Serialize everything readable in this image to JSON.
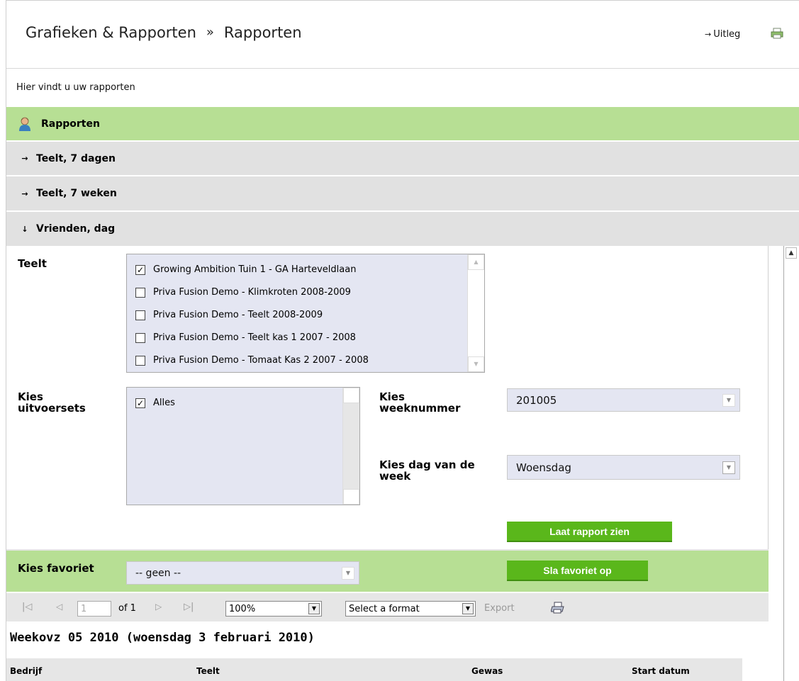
{
  "header": {
    "crumb_root": "Grafieken & Rapporten",
    "crumb_sep": "»",
    "crumb_current": "Rapporten",
    "uitleg_label": "Uitleg",
    "print_icon": "printer-icon"
  },
  "intro": "Hier vindt u uw rapporten",
  "sections": {
    "rapporten": "Rapporten",
    "teelt7dagen": "Teelt, 7 dagen",
    "teelt7weken": "Teelt, 7 weken",
    "vrienden": "Vrienden, dag",
    "collapsed_arrow": "→",
    "expanded_arrow": "↓"
  },
  "form": {
    "teelt_label": "Teelt",
    "teelt_items": [
      {
        "label": "Growing Ambition Tuin 1 - GA Harteveldlaan",
        "checked": true
      },
      {
        "label": "Priva Fusion Demo - Klimkroten 2008-2009",
        "checked": false
      },
      {
        "label": "Priva Fusion Demo - Teelt 2008-2009",
        "checked": false
      },
      {
        "label": "Priva Fusion Demo - Teelt kas 1 2007 - 2008",
        "checked": false
      },
      {
        "label": "Priva Fusion Demo - Tomaat Kas 2 2007 - 2008",
        "checked": false
      }
    ],
    "uitvoersets_label_1": "Kies",
    "uitvoersets_label_2": "uitvoersets",
    "uitvoersets_items": [
      {
        "label": "Alles",
        "checked": true
      }
    ],
    "weeknummer_label_1": "Kies",
    "weeknummer_label_2": "weeknummer",
    "weeknummer_value": "201005",
    "dag_label_1": "Kies dag van de",
    "dag_label_2": "week",
    "dag_value": "Woensdag",
    "show_button": "Laat rapport zien"
  },
  "favorites": {
    "label": "Kies favoriet",
    "value": "-- geen --",
    "save_button": "Sla favoriet op"
  },
  "toolbar": {
    "page_value": "1",
    "of_label": "of 1",
    "zoom_value": "100%",
    "format_value": "Select a format",
    "export_label": "Export"
  },
  "report": {
    "title": "Weekovz 05 2010 (woensdag 3 februari 2010)",
    "columns": [
      "Bedrijf",
      "Teelt",
      "Gewas",
      "Start datum"
    ]
  },
  "colors": {
    "section_green": "#b7df94",
    "section_grey": "#e1e1e1",
    "button_green": "#5ab71b",
    "field_bg": "#e4e6f2"
  }
}
